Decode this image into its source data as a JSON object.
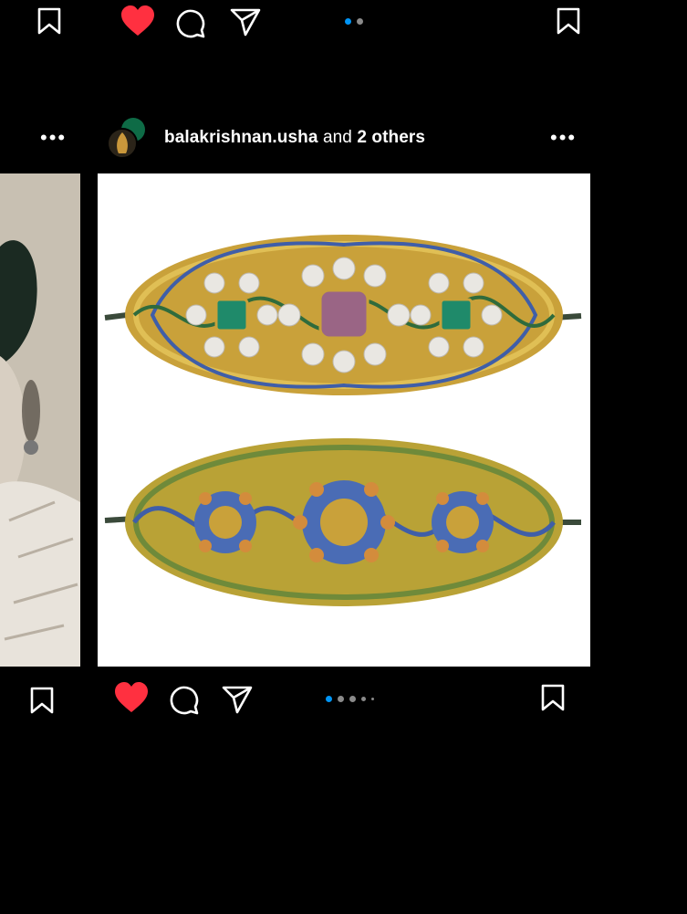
{
  "colors": {
    "like": "#ff3040",
    "active_dot": "#0095f6",
    "inactive_dot": "#8a8a8a",
    "background": "#000000"
  },
  "post": {
    "author": "balakrishnan.usha",
    "coauthor_text": "and",
    "others": "2 others",
    "more_label": "•••",
    "carousel": {
      "slides": 5,
      "active_index": 0
    }
  },
  "top_row": {
    "carousel": {
      "slides": 2,
      "active_index": 0
    }
  },
  "left_post": {
    "more_label": "•••"
  },
  "icons": {
    "bookmark": "bookmark-icon",
    "heart": "heart-icon",
    "comment": "comment-icon",
    "share": "share-icon",
    "more": "more-icon"
  }
}
